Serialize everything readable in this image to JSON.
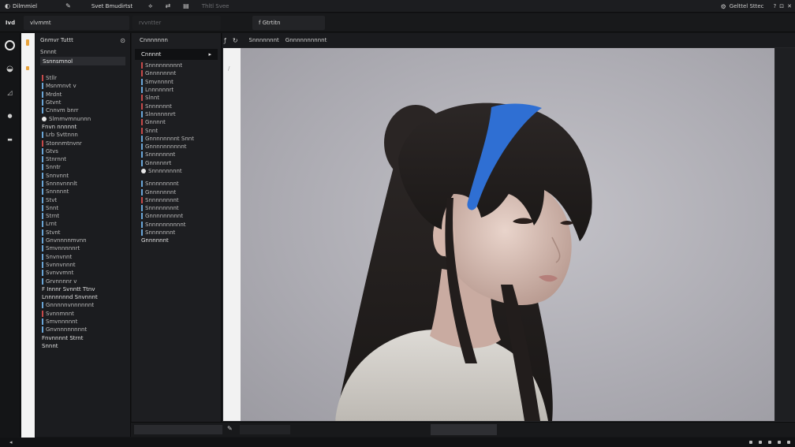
{
  "menubar": {
    "items": [
      {
        "icon": "app-logo-icon",
        "label": "Dilmmiel"
      },
      {
        "icon": "pen-icon",
        "label": ""
      },
      {
        "icon": "",
        "label": "Svet Bmudirtst"
      },
      {
        "icon": "brush-icon",
        "label": ""
      },
      {
        "icon": "arrows-icon",
        "label": ""
      },
      {
        "icon": "chart-icon",
        "label": ""
      },
      {
        "icon": "",
        "label": "Thltl  Svee"
      }
    ],
    "right": [
      "Gelttel Sttec",
      "?",
      "⊡",
      "✕"
    ]
  },
  "toolbar": {
    "app": "Ivd",
    "field1": "vlvmmt",
    "field2": "rvvntter",
    "field3": "f  Gtrtitn"
  },
  "left_panel": {
    "title": "Gnmvr Tuttt",
    "subtitle": "Snnnt",
    "selected": "Ssnnsmnol",
    "tree": [
      {
        "t": "Stllr",
        "c": "#c64a4a"
      },
      {
        "t": "Msnmnvt v",
        "c": "#6aa6d8"
      },
      {
        "t": "Mrdnt",
        "c": "#6aa6d8"
      },
      {
        "t": "Gtvnt",
        "c": "#6aa6d8"
      },
      {
        "t": "Cnnvm bnrr",
        "c": "#6aa6d8"
      },
      {
        "t": "Slmmvmnunnn",
        "c": "dot"
      },
      {
        "t": "Fnvn nnnnnt",
        "c": "group"
      },
      {
        "t": "Lrb  Svttnnn",
        "c": "#6aa6d8"
      },
      {
        "t": "Stonnmtnvnr",
        "c": "#c64a4a"
      },
      {
        "t": "Gtvs",
        "c": "#6aa6d8"
      },
      {
        "t": "Stnrnnt",
        "c": "#6aa6d8"
      },
      {
        "t": "Snntr",
        "c": "#6aa6d8"
      },
      {
        "t": "Snnvnnt",
        "c": "#6aa6d8"
      },
      {
        "t": "Snnnvnnnlt",
        "c": "#6aa6d8"
      },
      {
        "t": "Snnnnnt",
        "c": "#6aa6d8"
      },
      {
        "t": "Stvt",
        "c": "#6aa6d8"
      },
      {
        "t": "Snnt",
        "c": "#6aa6d8"
      },
      {
        "t": "Strnt",
        "c": "#6aa6d8"
      },
      {
        "t": "Lrnt",
        "c": "#6aa6d8"
      },
      {
        "t": "Stvnt",
        "c": "#6aa6d8"
      },
      {
        "t": "Gnvnnnnmvnn",
        "c": "#6aa6d8"
      },
      {
        "t": "Smvnnnnnrt",
        "c": "#6aa6d8"
      },
      {
        "t": "Snvnvnnt",
        "c": "#6aa6d8"
      },
      {
        "t": "Svnnvnnnt",
        "c": "#6aa6d8"
      },
      {
        "t": "Svnvvmnt",
        "c": "#6aa6d8"
      },
      {
        "t": "Grvnnnnr  v",
        "c": "#6aa6d8"
      },
      {
        "t": "F  Innnr  Svnntt  Ttnv",
        "c": "group"
      },
      {
        "t": "Lnnnnnnnd  Snvnnnt",
        "c": "group"
      },
      {
        "t": "Gnnnnnvnnnnnnt",
        "c": "#6aa6d8"
      },
      {
        "t": "Svnnmnnt",
        "c": "#c64a4a"
      },
      {
        "t": "Smvnnnnnt",
        "c": "#6aa6d8"
      },
      {
        "t": "Gnvnnnnnnnnt",
        "c": "#6aa6d8"
      },
      {
        "t": "Fnvnnnnt  Strnt",
        "c": "group"
      },
      {
        "t": "Snnnt",
        "c": "group"
      }
    ]
  },
  "mid_panel": {
    "title": "Cnnnnnnn",
    "selected": "Cnnnnt",
    "list": [
      {
        "t": "Snnnnnnnnnt",
        "c": "#c64a4a"
      },
      {
        "t": "Gnnnnnnnt",
        "c": "#c64a4a"
      },
      {
        "t": "Smvnnnnt",
        "c": "#6aa6d8"
      },
      {
        "t": "Lnnnnnnrt",
        "c": "#6aa6d8"
      },
      {
        "t": "Slnnt",
        "c": "#c64a4a"
      },
      {
        "t": "Snnnnnnt",
        "c": "#c64a4a"
      },
      {
        "t": "Slnnnnnnrt",
        "c": "#6aa6d8"
      },
      {
        "t": "Gnnnnt",
        "c": "#c64a4a"
      },
      {
        "t": "Snnt",
        "c": "#c64a4a"
      },
      {
        "t": "Gnnnnnnnnt  Snnt",
        "c": "#6aa6d8"
      },
      {
        "t": "Gnnnnnnnnnnt",
        "c": "#6aa6d8"
      },
      {
        "t": "Snnnnnnnt",
        "c": "#6aa6d8"
      },
      {
        "t": "Gnnnnnrt",
        "c": "#6aa6d8"
      },
      {
        "t": "Snnnnnnnnt",
        "c": "dot"
      },
      {
        "t": "",
        "c": "gap"
      },
      {
        "t": "Snnnnnnnnt",
        "c": "#6aa6d8"
      },
      {
        "t": "Gnnnnnnnt",
        "c": "#6aa6d8"
      },
      {
        "t": "Snnnnnnnnt",
        "c": "#c64a4a"
      },
      {
        "t": "Snnnnnnnnt",
        "c": "#6aa6d8"
      },
      {
        "t": "Gnnnnnnnnnt",
        "c": "#6aa6d8"
      },
      {
        "t": "Snnnnnnnnnnt",
        "c": "#6aa6d8"
      },
      {
        "t": "Snnnnnnnt",
        "c": "#6aa6d8"
      },
      {
        "t": "Gnnnnnnt",
        "c": "group"
      }
    ]
  },
  "canvas": {
    "tabs": [
      "Snnnnnnnt",
      "Gnnnnnnnnnnt"
    ]
  },
  "colors": {
    "accent_red": "#c64a4a",
    "accent_blue": "#6aa6d8",
    "headband": "#2f6fd3"
  }
}
